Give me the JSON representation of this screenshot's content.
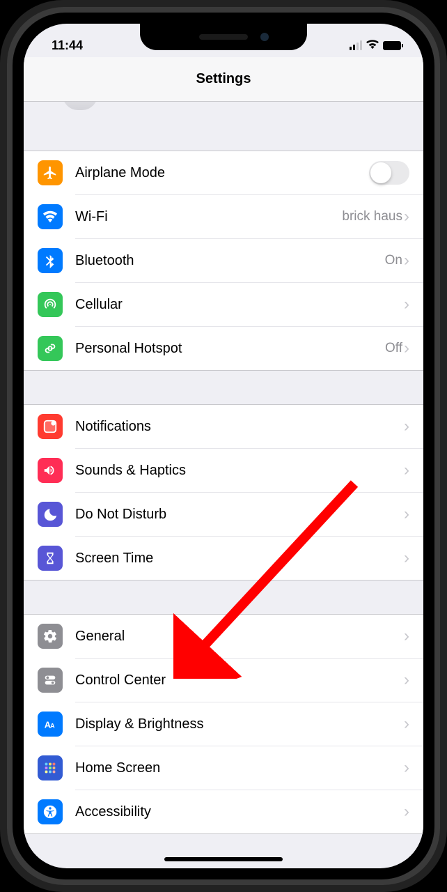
{
  "statusbar": {
    "time": "11:44"
  },
  "header": {
    "title": "Settings"
  },
  "rows": {
    "airplane": {
      "label": "Airplane Mode"
    },
    "wifi": {
      "label": "Wi-Fi",
      "detail": "brick haus"
    },
    "bluetooth": {
      "label": "Bluetooth",
      "detail": "On"
    },
    "cellular": {
      "label": "Cellular"
    },
    "hotspot": {
      "label": "Personal Hotspot",
      "detail": "Off"
    },
    "notif": {
      "label": "Notifications"
    },
    "sound": {
      "label": "Sounds & Haptics"
    },
    "dnd": {
      "label": "Do Not Disturb"
    },
    "screentime": {
      "label": "Screen Time"
    },
    "general": {
      "label": "General"
    },
    "control": {
      "label": "Control Center"
    },
    "display": {
      "label": "Display & Brightness"
    },
    "home": {
      "label": "Home Screen"
    },
    "access": {
      "label": "Accessibility"
    }
  },
  "annotation": {
    "target": "general"
  }
}
